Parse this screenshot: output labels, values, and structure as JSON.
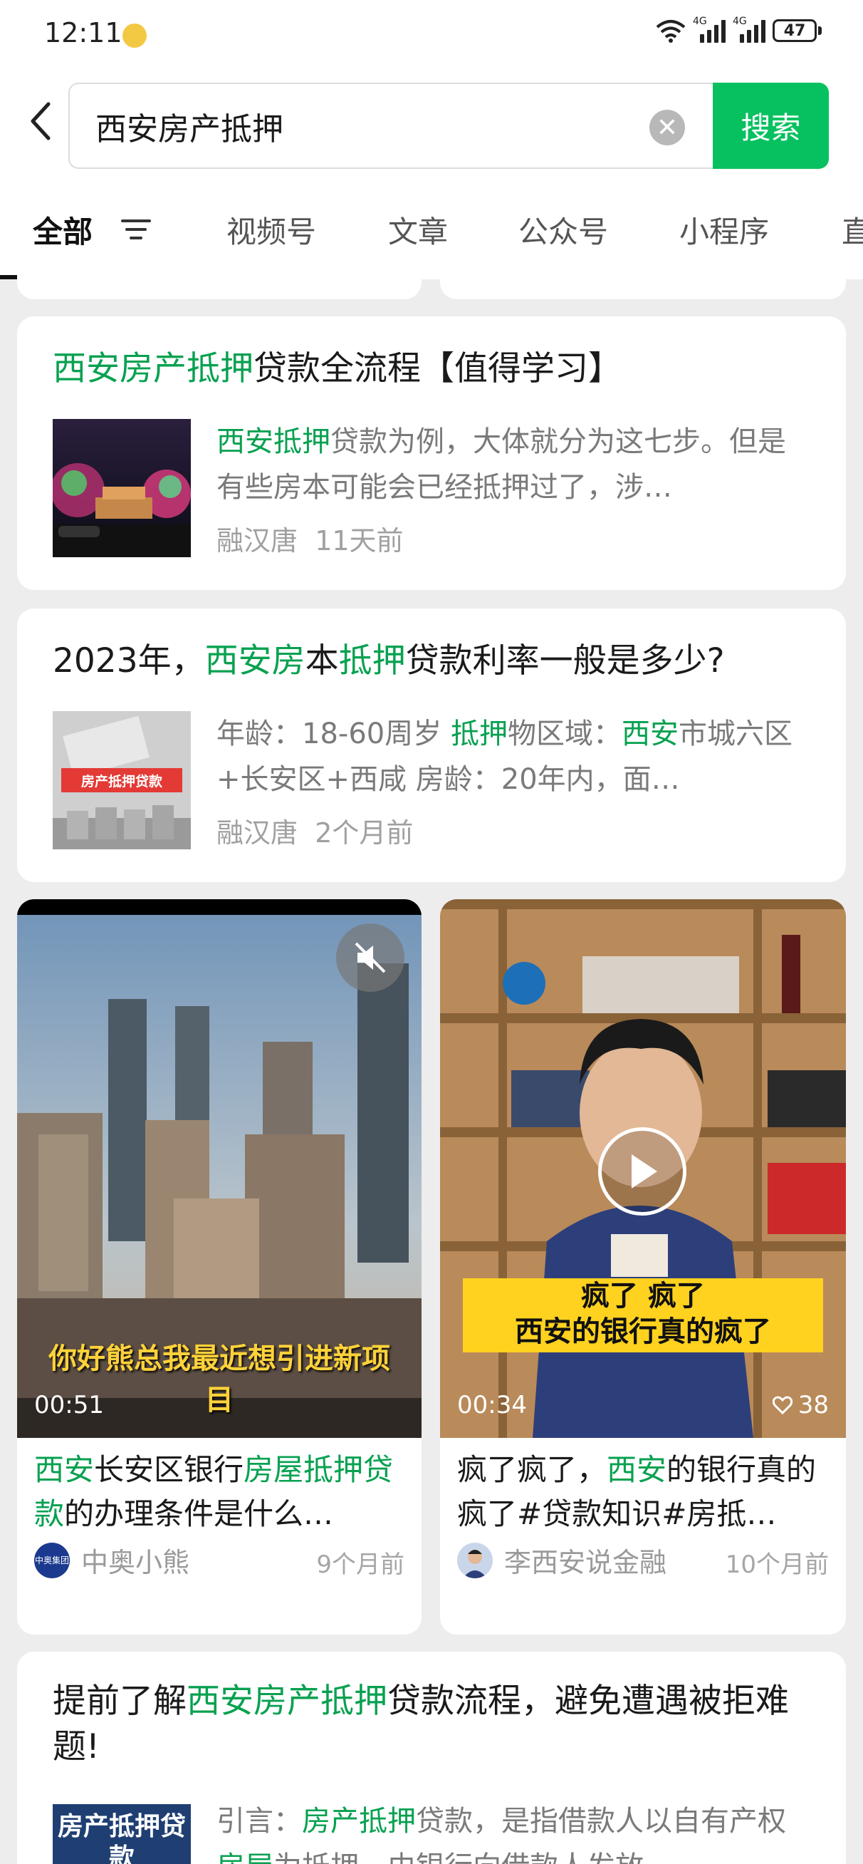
{
  "status_bar": {
    "time": "12:11",
    "network1": "4G",
    "network2": "4G",
    "battery": "47"
  },
  "search": {
    "query": "西安房产抵押",
    "button_label": "搜索"
  },
  "tabs": [
    {
      "label": "全部"
    },
    {
      "label": "视频号"
    },
    {
      "label": "文章"
    },
    {
      "label": "公众号"
    },
    {
      "label": "小程序"
    },
    {
      "label": "直"
    }
  ],
  "articles": [
    {
      "title": [
        {
          "t": "西安房产抵押",
          "hl": true
        },
        {
          "t": "贷款全流程【值得学习】",
          "hl": false
        }
      ],
      "snippet": [
        {
          "t": "西安抵押",
          "hl": true
        },
        {
          "t": "贷款为例，大体就分为这七步。但是有些房本可能会已经抵押过了，涉…",
          "hl": false
        }
      ],
      "source": "融汉唐",
      "time": "11天前"
    },
    {
      "title": [
        {
          "t": "2023年，",
          "hl": false
        },
        {
          "t": "西安房",
          "hl": true
        },
        {
          "t": "本",
          "hl": false
        },
        {
          "t": "抵押",
          "hl": true
        },
        {
          "t": "贷款利率一般是多少?",
          "hl": false
        }
      ],
      "snippet": [
        {
          "t": "年龄：18-60周岁 ",
          "hl": false
        },
        {
          "t": "抵押",
          "hl": true
        },
        {
          "t": "物区域：",
          "hl": false
        },
        {
          "t": "西安",
          "hl": true
        },
        {
          "t": "市城六区+长安区+西咸 房龄：20年内，面…",
          "hl": false
        }
      ],
      "thumb_text": "房产抵押贷款",
      "source": "融汉唐",
      "time": "2个月前"
    },
    {
      "title": [
        {
          "t": "提前了解",
          "hl": false
        },
        {
          "t": "西安房产抵押",
          "hl": true
        },
        {
          "t": "贷款流程，避免遭遇被拒难题!",
          "hl": false
        }
      ],
      "snippet": [
        {
          "t": "引言：",
          "hl": false
        },
        {
          "t": "房产抵押",
          "hl": true
        },
        {
          "t": "贷款，是指借款人以自有产权",
          "hl": false
        },
        {
          "t": "房屋",
          "hl": true
        },
        {
          "t": "为抵押，由银行向借款人发放…",
          "hl": false
        }
      ],
      "thumb_text": "房产抵押贷款"
    }
  ],
  "videos": [
    {
      "caption": "你好熊总我最近想引进新项目",
      "duration": "00:51",
      "title": [
        {
          "t": "西安",
          "hl": true
        },
        {
          "t": "长安区银行",
          "hl": false
        },
        {
          "t": "房屋抵押贷款",
          "hl": true
        },
        {
          "t": "的办理条件是什么…",
          "hl": false
        }
      ],
      "author": "中奥小熊",
      "avatar_text": "中奥集团",
      "time": "9个月前"
    },
    {
      "caption_line1": "疯了 疯了",
      "caption_line2": "西安的银行真的疯了",
      "duration": "00:34",
      "likes": "38",
      "title": [
        {
          "t": "疯了疯了，",
          "hl": false
        },
        {
          "t": "西安",
          "hl": true
        },
        {
          "t": "的银行真的疯了#贷款知识#房抵…",
          "hl": false
        }
      ],
      "author": "李西安说金融",
      "time": "10个月前"
    }
  ],
  "colors": {
    "accent": "#07c160",
    "highlight": "#07a150",
    "background": "#ededed"
  }
}
